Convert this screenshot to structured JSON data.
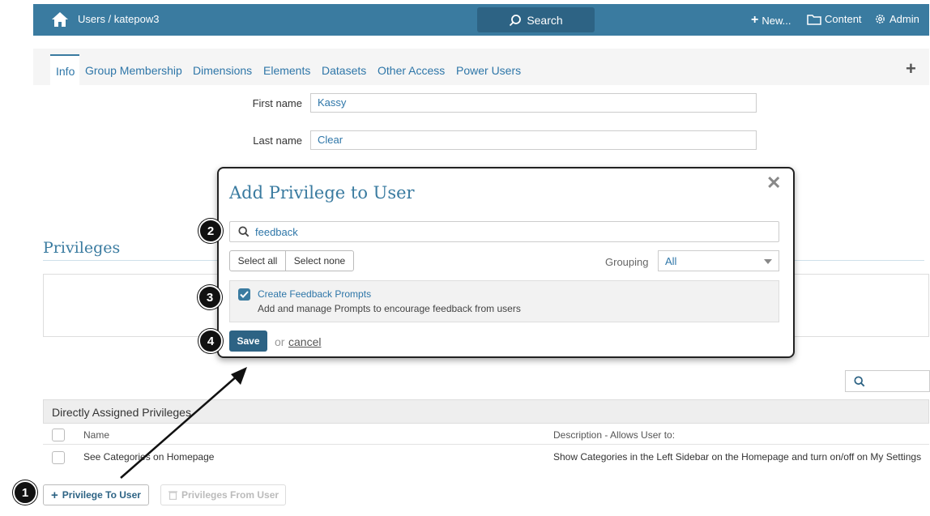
{
  "topbar": {
    "breadcrumb": "Users / katepow3",
    "search_label": "Search",
    "new_label": "New...",
    "content_label": "Content",
    "admin_label": "Admin"
  },
  "tabs": [
    "Info",
    "Group Membership",
    "Dimensions",
    "Elements",
    "Datasets",
    "Other Access",
    "Power Users"
  ],
  "form": {
    "first_name_label": "First name",
    "first_name_value": "Kassy",
    "last_name_label": "Last name",
    "last_name_value": "Clear"
  },
  "privileges": {
    "title": "Privileges",
    "table_title": "Directly Assigned Privileges",
    "col_name": "Name",
    "col_description": "Description - Allows User to:",
    "rows": [
      {
        "name": "See Categories on Homepage",
        "description": "Show Categories in the Left Sidebar on the Homepage and turn on/off on My Settings"
      }
    ],
    "add_button": "Privilege To User",
    "remove_button": "Privileges From User"
  },
  "modal": {
    "title": "Add Privilege to User",
    "search_value": "feedback",
    "select_all": "Select all",
    "select_none": "Select none",
    "grouping_label": "Grouping",
    "grouping_value": "All",
    "item_name": "Create Feedback Prompts",
    "item_description": "Add and manage Prompts to encourage feedback from users",
    "save_label": "Save",
    "or_text": "or",
    "cancel_label": "cancel"
  },
  "callouts": [
    "1",
    "2",
    "3",
    "4"
  ],
  "colors": {
    "header": "#3a7ba0",
    "button_dark": "#2d6384",
    "link": "#2e76a8"
  }
}
